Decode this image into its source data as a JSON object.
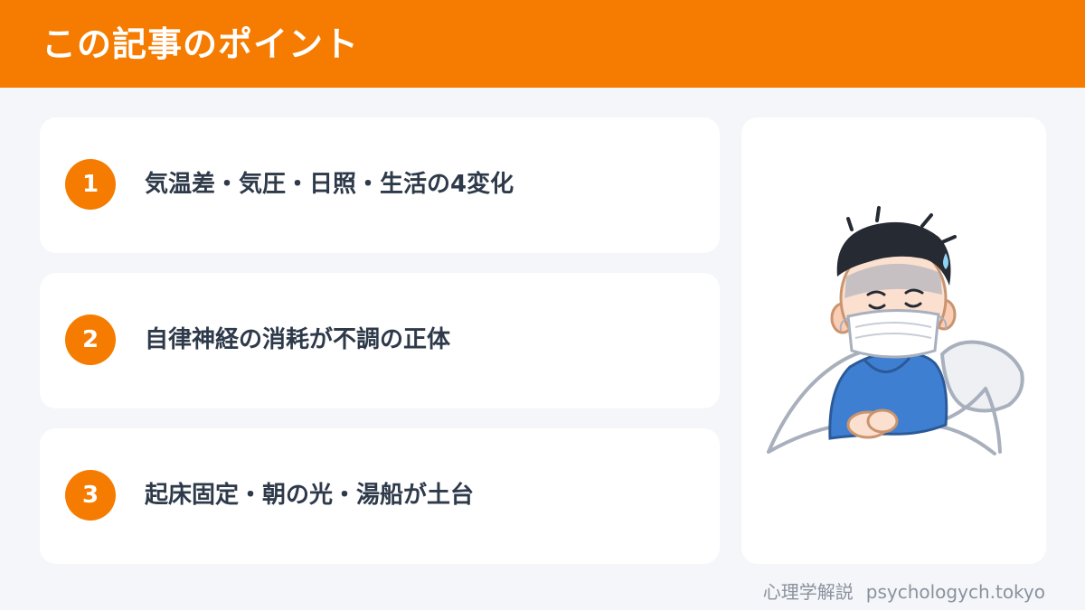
{
  "header": {
    "title": "この記事のポイント"
  },
  "points": [
    {
      "number": "1",
      "text": "気温差・気圧・日照・生活の4変化"
    },
    {
      "number": "2",
      "text": "自律神経の消耗が不調の正体"
    },
    {
      "number": "3",
      "text": "起床固定・朝の光・湯船が土台"
    }
  ],
  "footer": {
    "site_name": "心理学解説",
    "site_url": "psychologych.tokyo"
  },
  "colors": {
    "accent": "#f57c00",
    "background": "#f5f6fa",
    "card": "#ffffff",
    "text": "#2e3a4a"
  },
  "illustration": {
    "icon": "sick-boy-with-mask-in-bed-icon"
  }
}
